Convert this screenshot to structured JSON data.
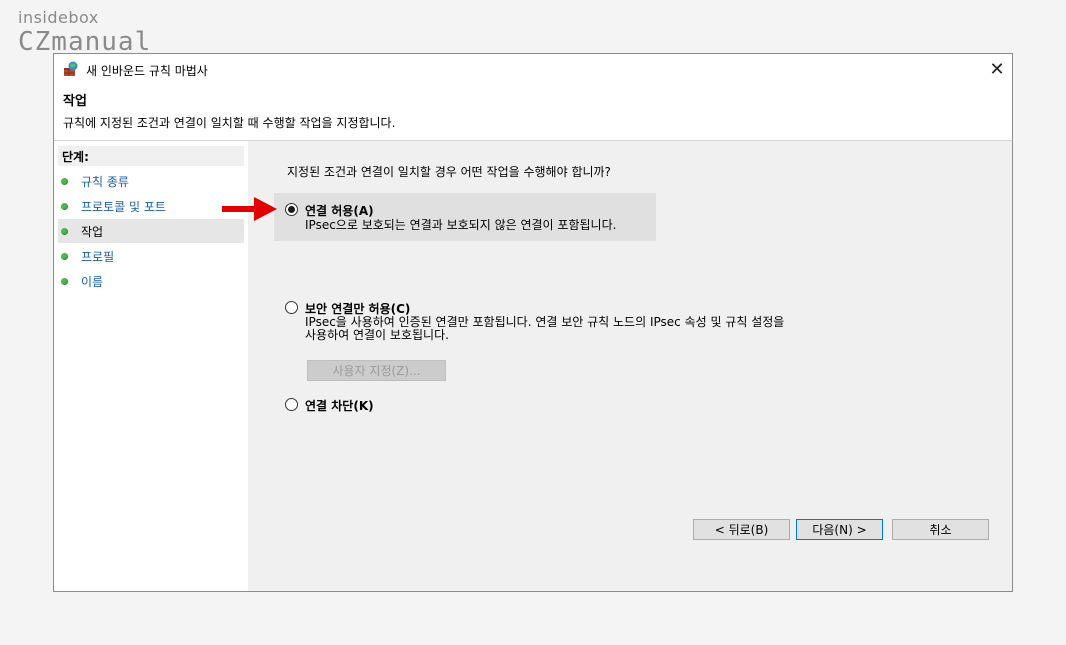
{
  "watermark": {
    "top": "insidebox",
    "bottom": "CZmanual"
  },
  "window": {
    "title": "새 인바운드 규칙 마법사",
    "close_glyph": "✕"
  },
  "header": {
    "title": "작업",
    "description": "규칙에 지정된 조건과 연결이 일치할 때 수행할 작업을 지정합니다."
  },
  "sidebar": {
    "label": "단계:",
    "items": [
      {
        "label": "규칙 종류",
        "active": false
      },
      {
        "label": "프로토콜 및 포트",
        "active": false
      },
      {
        "label": "작업",
        "active": true
      },
      {
        "label": "프로필",
        "active": false
      },
      {
        "label": "이름",
        "active": false
      }
    ]
  },
  "content": {
    "question": "지정된 조건과 연결이 일치할 경우 어떤 작업을 수행해야 합니까?",
    "options": [
      {
        "label": "연결 허용(A)",
        "checked": true,
        "description": [
          "IPsec으로 보호되는 연결과 보호되지 않은 연결이 포함됩니다."
        ]
      },
      {
        "label": "보안 연결만 허용(C)",
        "checked": false,
        "description": [
          "IPsec을 사용하여 인증된 연결만 포함됩니다. 연결 보안 규칙 노드의 IPsec 속성 및 규칙 설정을",
          "사용하여 연결이 보호됩니다."
        ]
      },
      {
        "label": "연결 차단(K)",
        "checked": false,
        "description": []
      }
    ],
    "customize_button": "사용자 지정(Z)..."
  },
  "footer": {
    "back": "< 뒤로(B)",
    "next": "다음(N) >",
    "cancel": "취소"
  },
  "colors": {
    "accent_arrow": "#e00000",
    "step_dot": "#4bb84b",
    "link": "#1a5fa0",
    "primary_border": "#0078d7"
  }
}
